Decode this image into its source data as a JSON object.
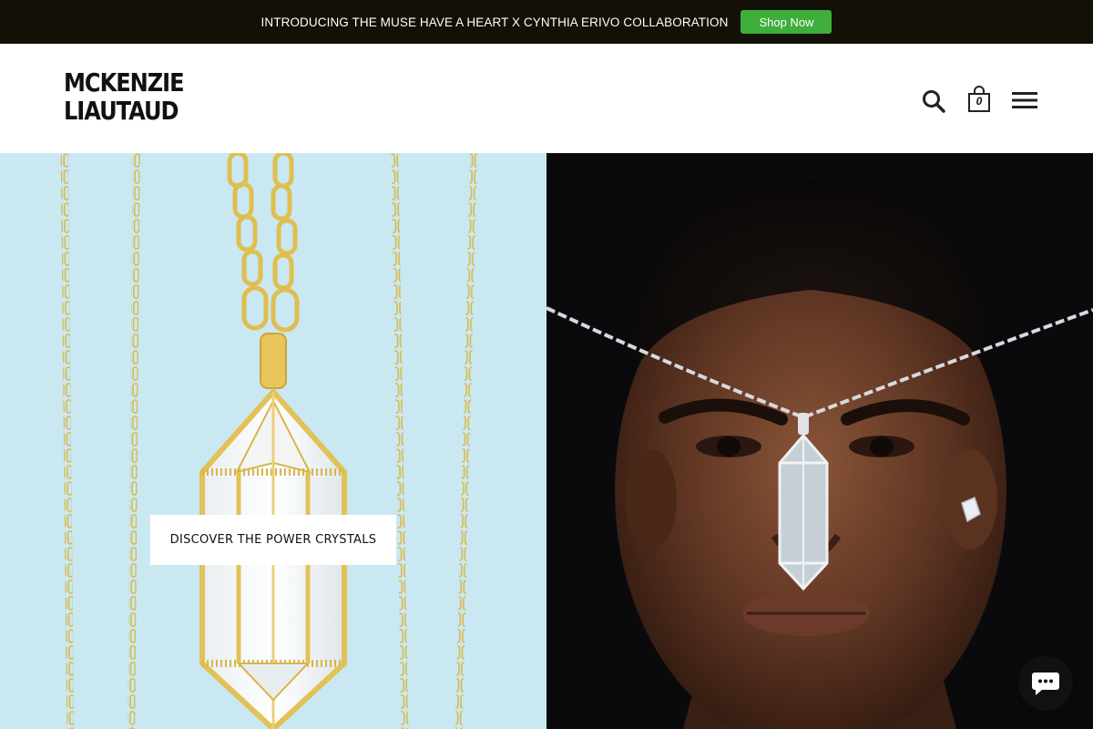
{
  "announcement": {
    "text": "INTRODUCING THE MUSE HAVE A HEART X CYNTHIA ERIVO COLLABORATION",
    "button_label": "Shop Now",
    "colors": {
      "bar": "#131008",
      "button": "#3fae3c"
    }
  },
  "header": {
    "logo_line1": "MCKENZIE",
    "logo_line2": "LIAUTAUD",
    "icons": [
      "search-icon",
      "cart-icon",
      "menu-icon"
    ],
    "cart_count": "0"
  },
  "hero": {
    "left": {
      "cta_label": "DISCOVER THE POWER CRYSTALS",
      "background": "#c9e8f2",
      "image": "gold-chain-crystal-pendant"
    },
    "right": {
      "background": "#0a0a0d",
      "image": "model-wearing-crystal-pendant"
    }
  },
  "chat": {
    "icon": "chat-bubble-icon"
  }
}
